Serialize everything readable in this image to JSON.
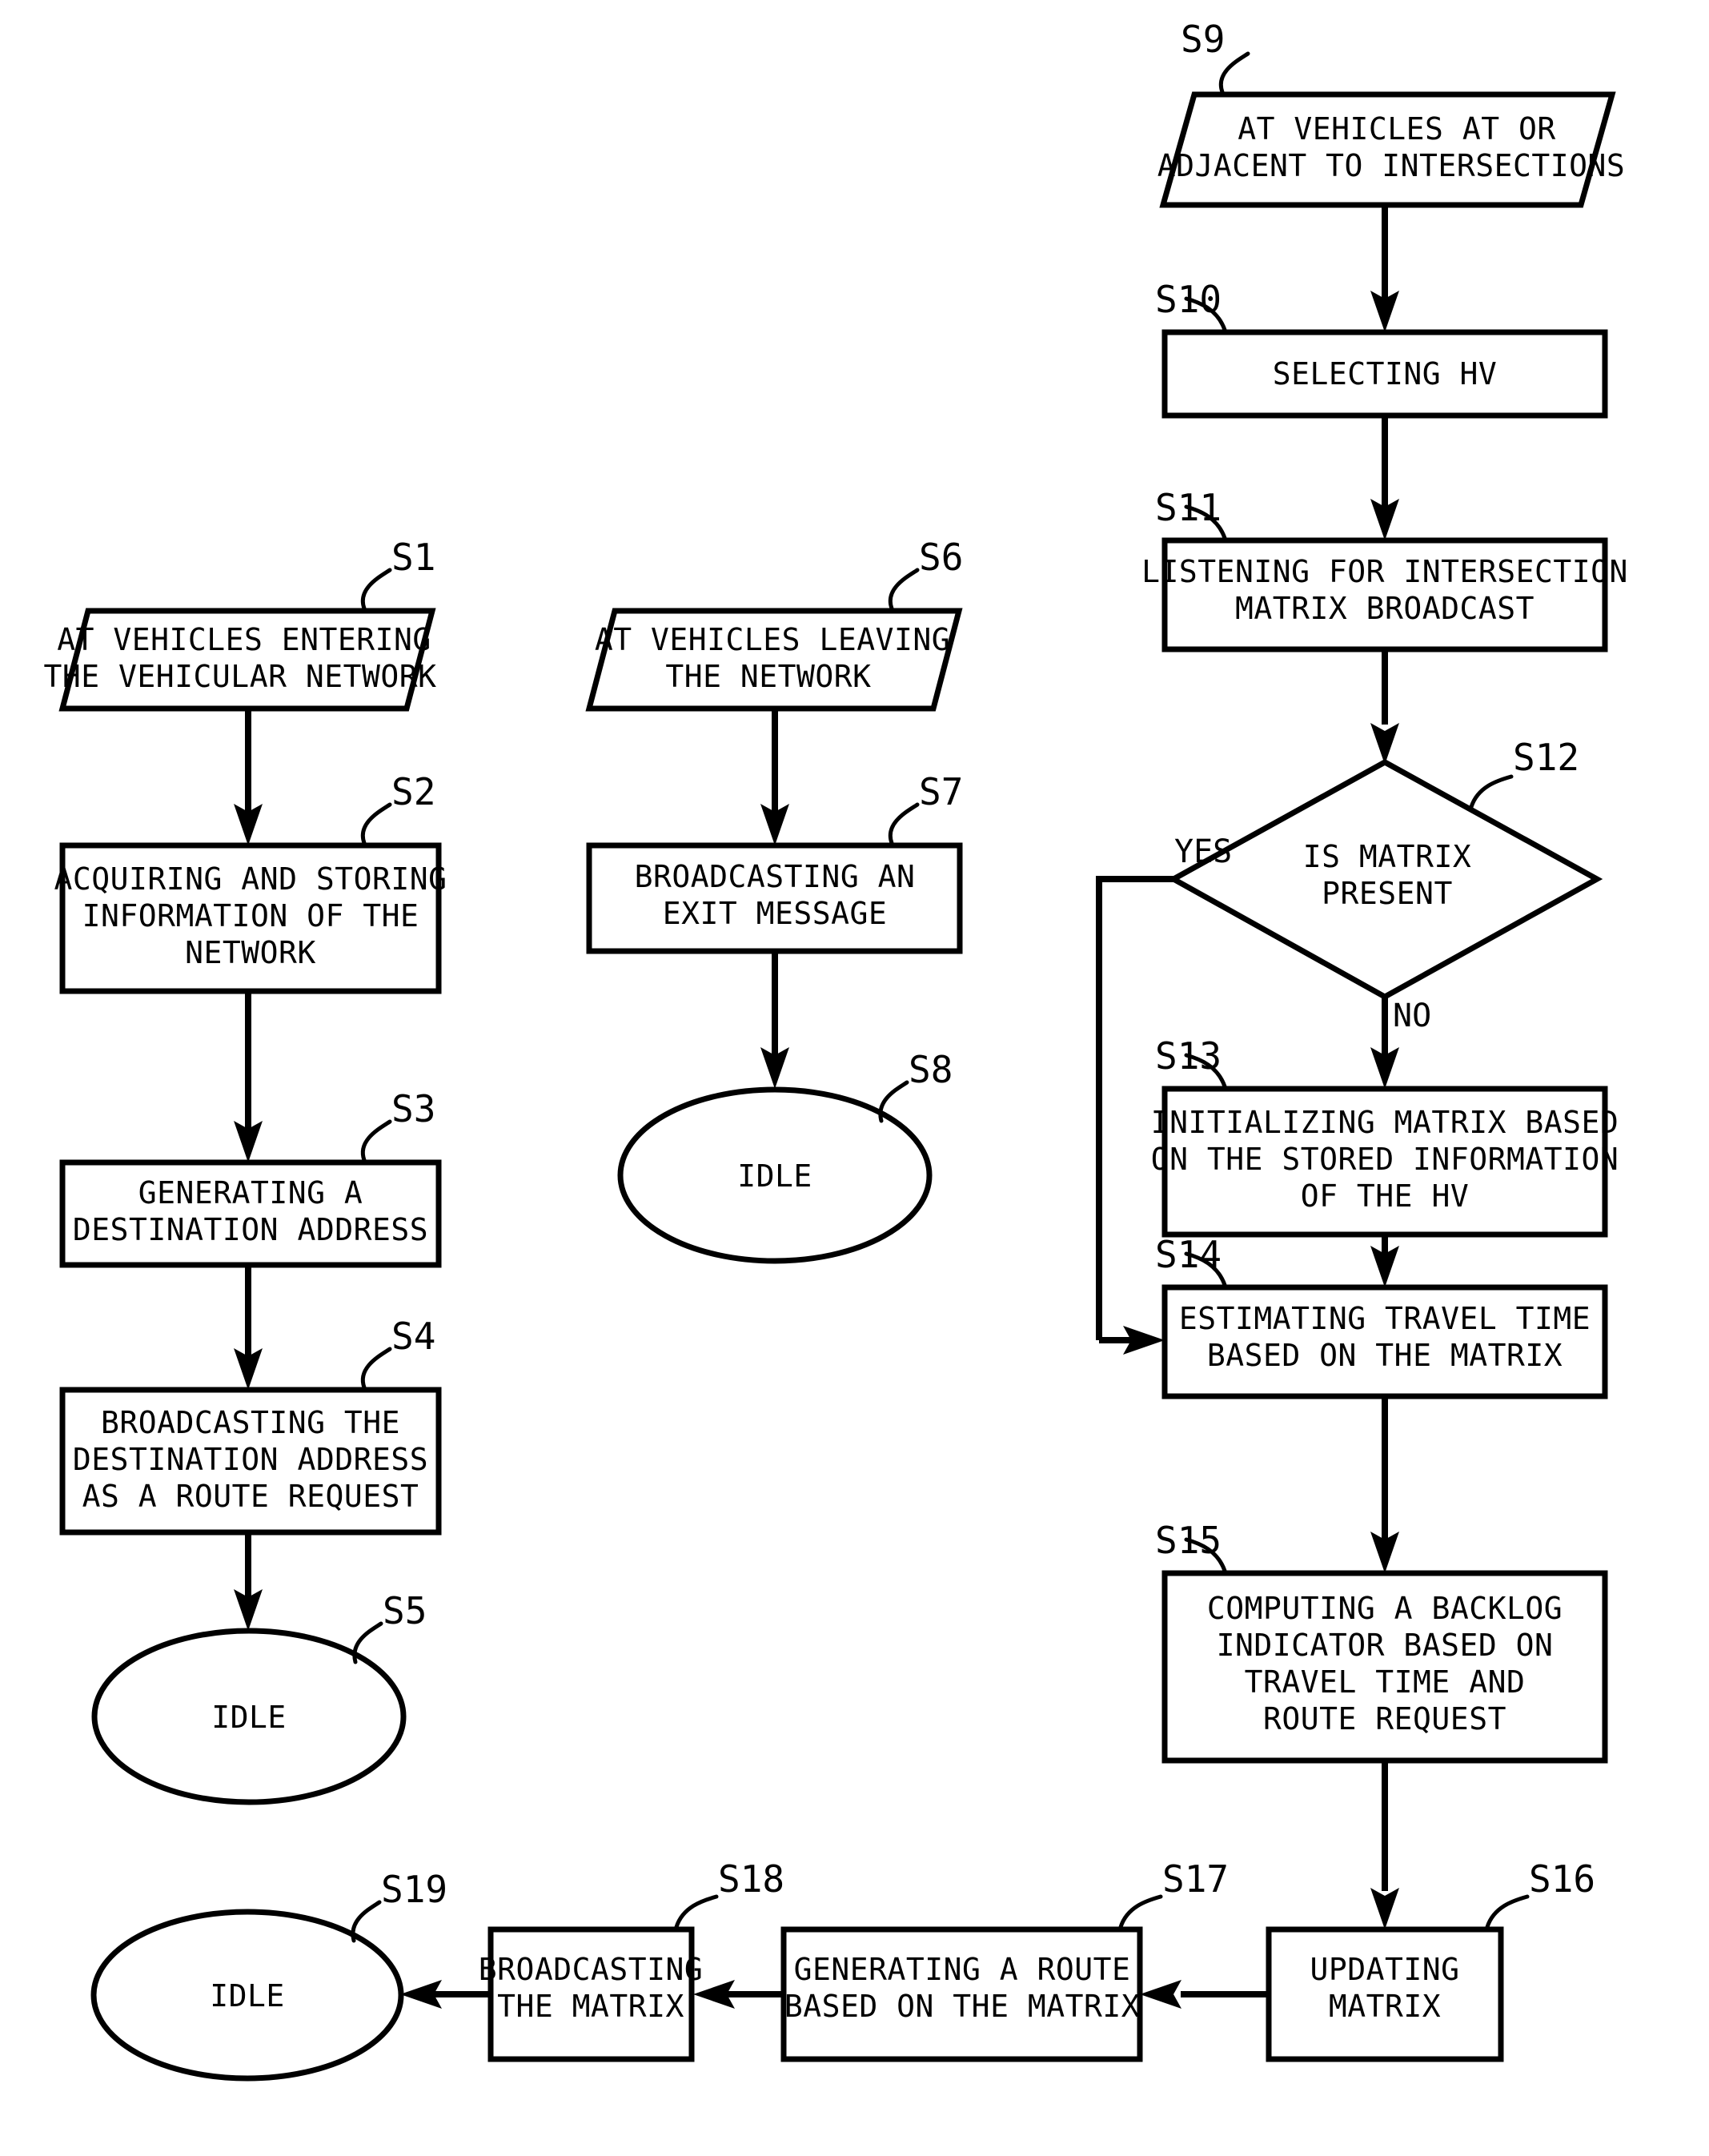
{
  "diagram": {
    "type": "flowchart",
    "nodes": [
      {
        "id": "S9",
        "label": "S9",
        "shape": "parallelogram",
        "lines": [
          "AT VEHICLES AT OR",
          "ADJACENT TO INTERSECTIONS"
        ]
      },
      {
        "id": "S10",
        "label": "S10",
        "shape": "process",
        "lines": [
          "SELECTING HV"
        ]
      },
      {
        "id": "S11",
        "label": "S11",
        "shape": "process",
        "lines": [
          "LISTENING FOR INTERSECTION",
          "MATRIX BROADCAST"
        ]
      },
      {
        "id": "S12",
        "label": "S12",
        "shape": "decision",
        "lines": [
          "IS MATRIX",
          "PRESENT"
        ]
      },
      {
        "id": "S13",
        "label": "S13",
        "shape": "process",
        "lines": [
          "INITIALIZING MATRIX BASED",
          "ON THE STORED INFORMATION",
          "OF THE HV"
        ]
      },
      {
        "id": "S14",
        "label": "S14",
        "shape": "process",
        "lines": [
          "ESTIMATING TRAVEL TIME",
          "BASED ON THE MATRIX"
        ]
      },
      {
        "id": "S15",
        "label": "S15",
        "shape": "process",
        "lines": [
          "COMPUTING A BACKLOG",
          "INDICATOR BASED ON",
          "TRAVEL TIME AND",
          "ROUTE REQUEST"
        ]
      },
      {
        "id": "S16",
        "label": "S16",
        "shape": "process",
        "lines": [
          "UPDATING",
          "MATRIX"
        ]
      },
      {
        "id": "S17",
        "label": "S17",
        "shape": "process",
        "lines": [
          "GENERATING A ROUTE",
          "BASED ON THE MATRIX"
        ]
      },
      {
        "id": "S18",
        "label": "S18",
        "shape": "process",
        "lines": [
          "BROADCASTING",
          "THE MATRIX"
        ]
      },
      {
        "id": "S19",
        "label": "S19",
        "shape": "terminator",
        "lines": [
          "IDLE"
        ]
      },
      {
        "id": "S1",
        "label": "S1",
        "shape": "parallelogram",
        "lines": [
          "AT VEHICLES ENTERING",
          "THE VEHICULAR NETWORK"
        ]
      },
      {
        "id": "S2",
        "label": "S2",
        "shape": "process",
        "lines": [
          "ACQUIRING AND STORING",
          "INFORMATION OF THE",
          "NETWORK"
        ]
      },
      {
        "id": "S3",
        "label": "S3",
        "shape": "process",
        "lines": [
          "GENERATING A",
          "DESTINATION ADDRESS"
        ]
      },
      {
        "id": "S4",
        "label": "S4",
        "shape": "process",
        "lines": [
          "BROADCASTING THE",
          "DESTINATION ADDRESS",
          "AS A ROUTE REQUEST"
        ]
      },
      {
        "id": "S5",
        "label": "S5",
        "shape": "terminator",
        "lines": [
          "IDLE"
        ]
      },
      {
        "id": "S6",
        "label": "S6",
        "shape": "parallelogram",
        "lines": [
          "AT VEHICLES LEAVING",
          "THE NETWORK"
        ]
      },
      {
        "id": "S7",
        "label": "S7",
        "shape": "process",
        "lines": [
          "BROADCASTING AN",
          "EXIT MESSAGE"
        ]
      },
      {
        "id": "S8",
        "label": "S8",
        "shape": "terminator",
        "lines": [
          "IDLE"
        ]
      }
    ],
    "branch_labels": {
      "yes": "YES",
      "no": "NO"
    },
    "colors": {
      "stroke": "#000000",
      "fill": "#ffffff"
    }
  }
}
